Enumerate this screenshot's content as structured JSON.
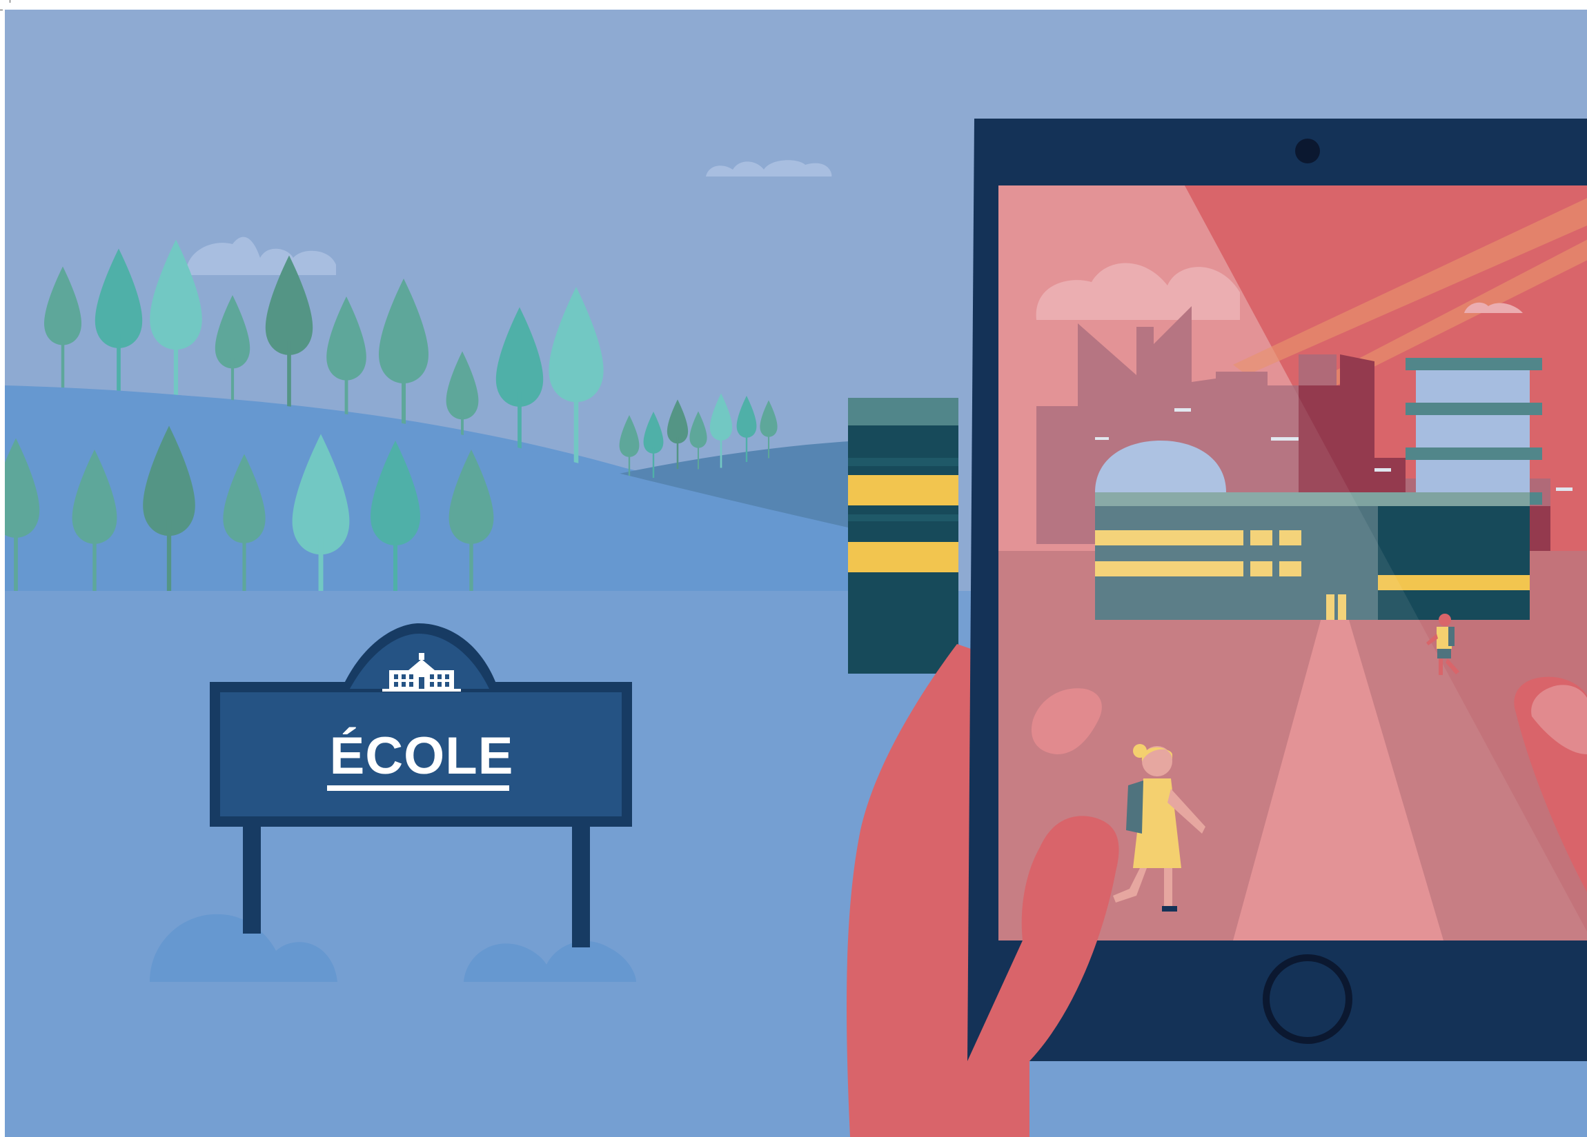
{
  "sign": {
    "label": "ÉCOLE"
  },
  "colors": {
    "sky": "#8eaad2",
    "hill": "#6698d0",
    "ground": "#759fd2",
    "sign_panel": "#255384",
    "sign_frame": "#173b63",
    "tablet_body": "#143257",
    "hand": "#d9646a",
    "screen_sky": "#e18a8e",
    "screen_ground": "#c3737a",
    "building": "#4f737e",
    "window_yellow": "#f4d06f"
  },
  "icons": [
    "school-building-icon",
    "camera-icon",
    "home-button-icon"
  ]
}
